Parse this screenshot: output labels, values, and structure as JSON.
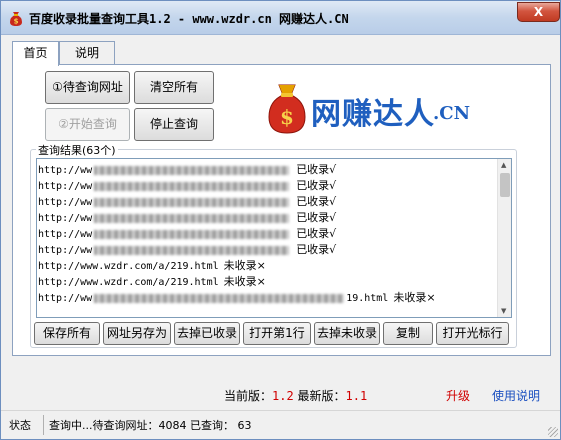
{
  "window": {
    "title": "百度收录批量查询工具1.2 - www.wzdr.cn 网赚达人.CN",
    "close_label": "X"
  },
  "tabs": [
    {
      "label": "首页",
      "active": true
    },
    {
      "label": "说明",
      "active": false
    }
  ],
  "controls": {
    "import_urls": "①待查询网址",
    "clear_all": "清空所有",
    "start_query": "②开始查询",
    "stop_query": "停止查询"
  },
  "logo": {
    "text": "网赚达人",
    "suffix": ".CN"
  },
  "results": {
    "group_label": "查询结果(63个)",
    "rows": [
      {
        "prefix": "http://ww",
        "status": "已收录√",
        "redacted": true
      },
      {
        "prefix": "http://ww",
        "status": "已收录√",
        "redacted": true
      },
      {
        "prefix": "http://ww",
        "status": "已收录√",
        "redacted": true
      },
      {
        "prefix": "http://ww",
        "status": "已收录√",
        "redacted": true
      },
      {
        "prefix": "http://ww",
        "status": "已收录√",
        "redacted": true
      },
      {
        "prefix": "http://ww",
        "status": "已收录√",
        "redacted": true
      },
      {
        "url": "http://www.wzdr.com/a/219.html",
        "status": "未收录×"
      },
      {
        "url": "http://www.wzdr.com/a/219.html",
        "status": "未收录×"
      },
      {
        "prefix": "http://ww",
        "suffix": "19.html",
        "status": "未收录×",
        "redacted": true
      }
    ]
  },
  "actions": [
    "保存所有",
    "网址另存为",
    "去掉已收录",
    "打开第1行",
    "去掉未收录",
    "复制",
    "打开光标行"
  ],
  "version": {
    "current_label": "当前版：",
    "current_value": "1.2",
    "latest_label": "最新版：",
    "latest_value": "1.1",
    "upgrade_link": "升级",
    "help_link": "使用说明"
  },
  "statusbar": {
    "label": "状态",
    "text": "查询中...待查询网址：4084 已查询： 63"
  },
  "colors": {
    "accent_blue": "#1f5fbf",
    "version_red": "#d00000",
    "help_link_blue": "#1a4fc0"
  }
}
